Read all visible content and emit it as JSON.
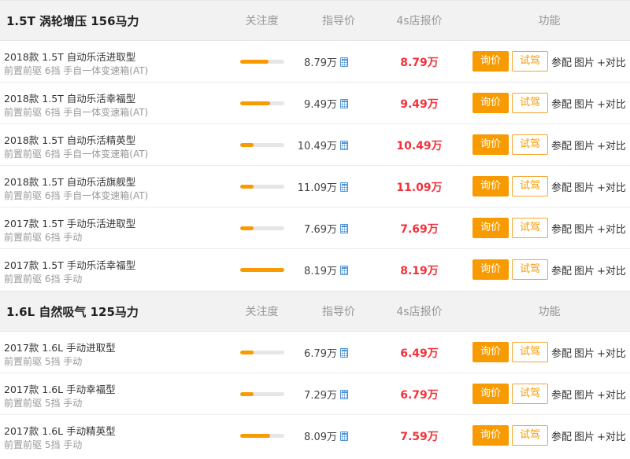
{
  "columns": {
    "focus": "关注度",
    "guide": "指导价",
    "dealer": "4s店报价",
    "function": "功能"
  },
  "actions": {
    "ask": "询价",
    "test": "试驾",
    "config": "参配",
    "pics": "图片",
    "compare": "+对比"
  },
  "colors": {
    "accent": "#f89b00",
    "price": "#f2313b",
    "bar_track": "#e6e6e6",
    "calc_icon": "#4a90d9"
  },
  "sections": [
    {
      "engine": "1.5T 涡轮增压 156马力",
      "models": [
        {
          "name": "2018款 1.5T 自动乐活进取型",
          "spec": "前置前驱 6挡 手自一体变速箱(AT)",
          "guide": "8.79万",
          "dealer": "8.79万",
          "focus": 0.65
        },
        {
          "name": "2018款 1.5T 自动乐活幸福型",
          "spec": "前置前驱 6挡 手自一体变速箱(AT)",
          "guide": "9.49万",
          "dealer": "9.49万",
          "focus": 0.67
        },
        {
          "name": "2018款 1.5T 自动乐活精英型",
          "spec": "前置前驱 6挡 手自一体变速箱(AT)",
          "guide": "10.49万",
          "dealer": "10.49万",
          "focus": 0.3
        },
        {
          "name": "2018款 1.5T 自动乐活旗舰型",
          "spec": "前置前驱 6挡 手自一体变速箱(AT)",
          "guide": "11.09万",
          "dealer": "11.09万",
          "focus": 0.3
        },
        {
          "name": "2017款 1.5T 手动乐活进取型",
          "spec": "前置前驱 6挡 手动",
          "guide": "7.69万",
          "dealer": "7.69万",
          "focus": 0.3
        },
        {
          "name": "2017款 1.5T 手动乐活幸福型",
          "spec": "前置前驱 6挡 手动",
          "guide": "8.19万",
          "dealer": "8.19万",
          "focus": 1.0
        }
      ]
    },
    {
      "engine": "1.6L 自然吸气 125马力",
      "models": [
        {
          "name": "2017款 1.6L 手动进取型",
          "spec": "前置前驱 5挡 手动",
          "guide": "6.79万",
          "dealer": "6.49万",
          "focus": 0.3
        },
        {
          "name": "2017款 1.6L 手动幸福型",
          "spec": "前置前驱 5挡 手动",
          "guide": "7.29万",
          "dealer": "6.79万",
          "focus": 0.3
        },
        {
          "name": "2017款 1.6L 手动精英型",
          "spec": "前置前驱 5挡 手动",
          "guide": "8.09万",
          "dealer": "7.59万",
          "focus": 0.67
        }
      ]
    }
  ]
}
